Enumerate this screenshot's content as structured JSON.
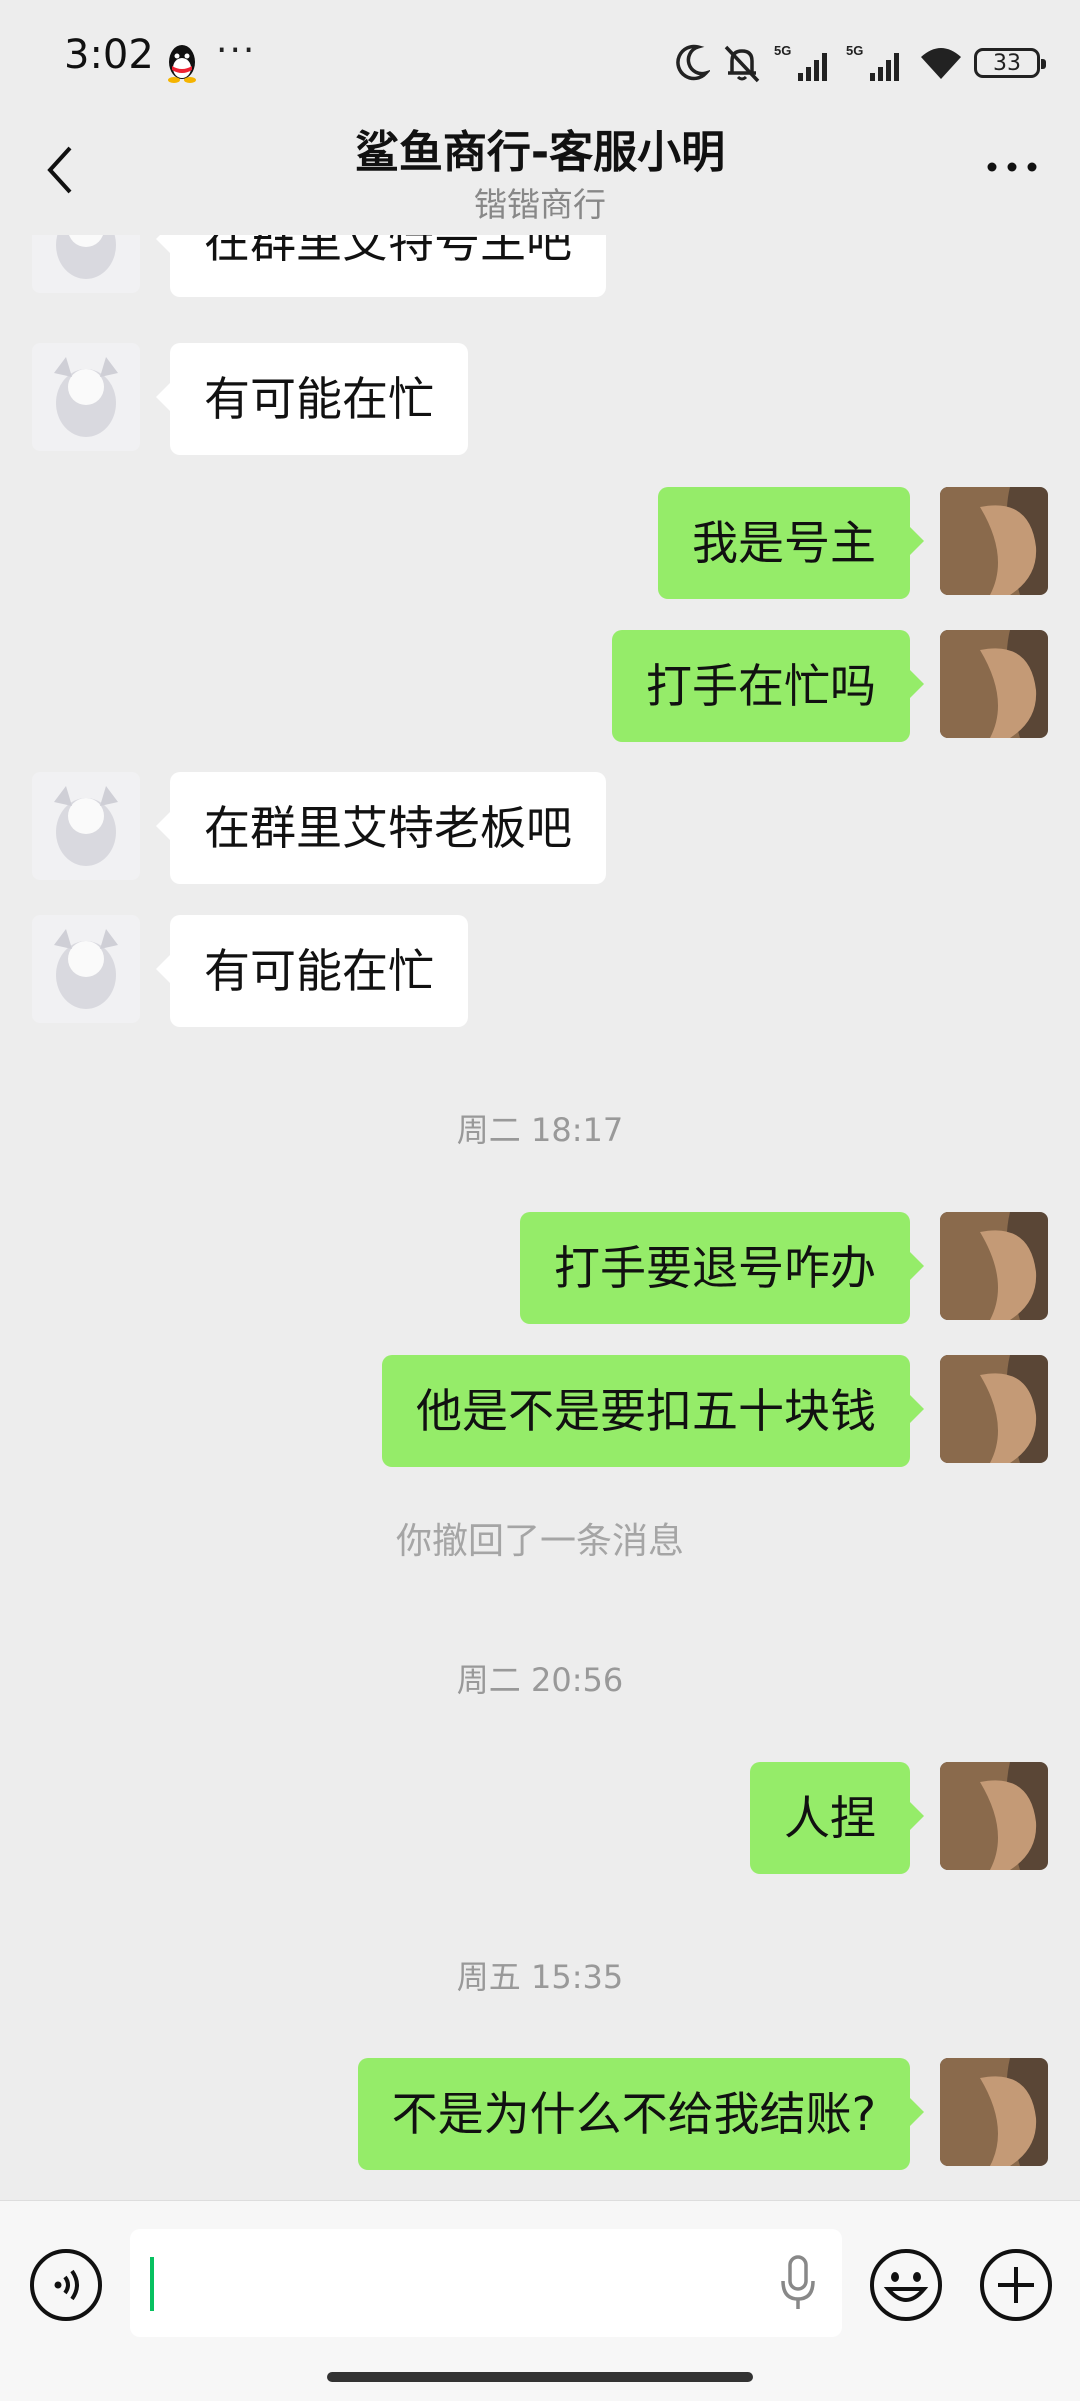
{
  "status_bar": {
    "time": "3:02",
    "more": "···",
    "battery": "33",
    "icons": [
      "qq-icon",
      "moon-icon",
      "silent-bell-icon",
      "signal-5g-icon",
      "signal-5g-icon",
      "wifi-icon",
      "battery-icon"
    ]
  },
  "header": {
    "title": "鲨鱼商行-客服小明",
    "subtitle": "锴锴商行",
    "back_icon": "chevron-left-icon",
    "more_icon": "more-horizontal-icon"
  },
  "messages": [
    {
      "side": "in",
      "text": "在群里艾特号主吧"
    },
    {
      "side": "in",
      "text": "有可能在忙"
    },
    {
      "side": "out",
      "text": "我是号主"
    },
    {
      "side": "out",
      "text": "打手在忙吗"
    },
    {
      "side": "in",
      "text": "在群里艾特老板吧"
    },
    {
      "side": "in",
      "text": "有可能在忙"
    },
    {
      "side": "time",
      "text": "周二 18:17"
    },
    {
      "side": "out",
      "text": "打手要退号咋办"
    },
    {
      "side": "out",
      "text": "他是不是要扣五十块钱"
    },
    {
      "side": "recall",
      "text": "你撤回了一条消息"
    },
    {
      "side": "time",
      "text": "周二 20:56"
    },
    {
      "side": "out",
      "text": "人捏"
    },
    {
      "side": "time",
      "text": "周五 15:35"
    },
    {
      "side": "out",
      "text": "不是为什么不给我结账?"
    }
  ],
  "input_bar": {
    "voice_icon": "voice-icon",
    "mic_icon": "mic-icon",
    "emoji_icon": "emoji-icon",
    "plus_icon": "plus-icon",
    "value": ""
  }
}
